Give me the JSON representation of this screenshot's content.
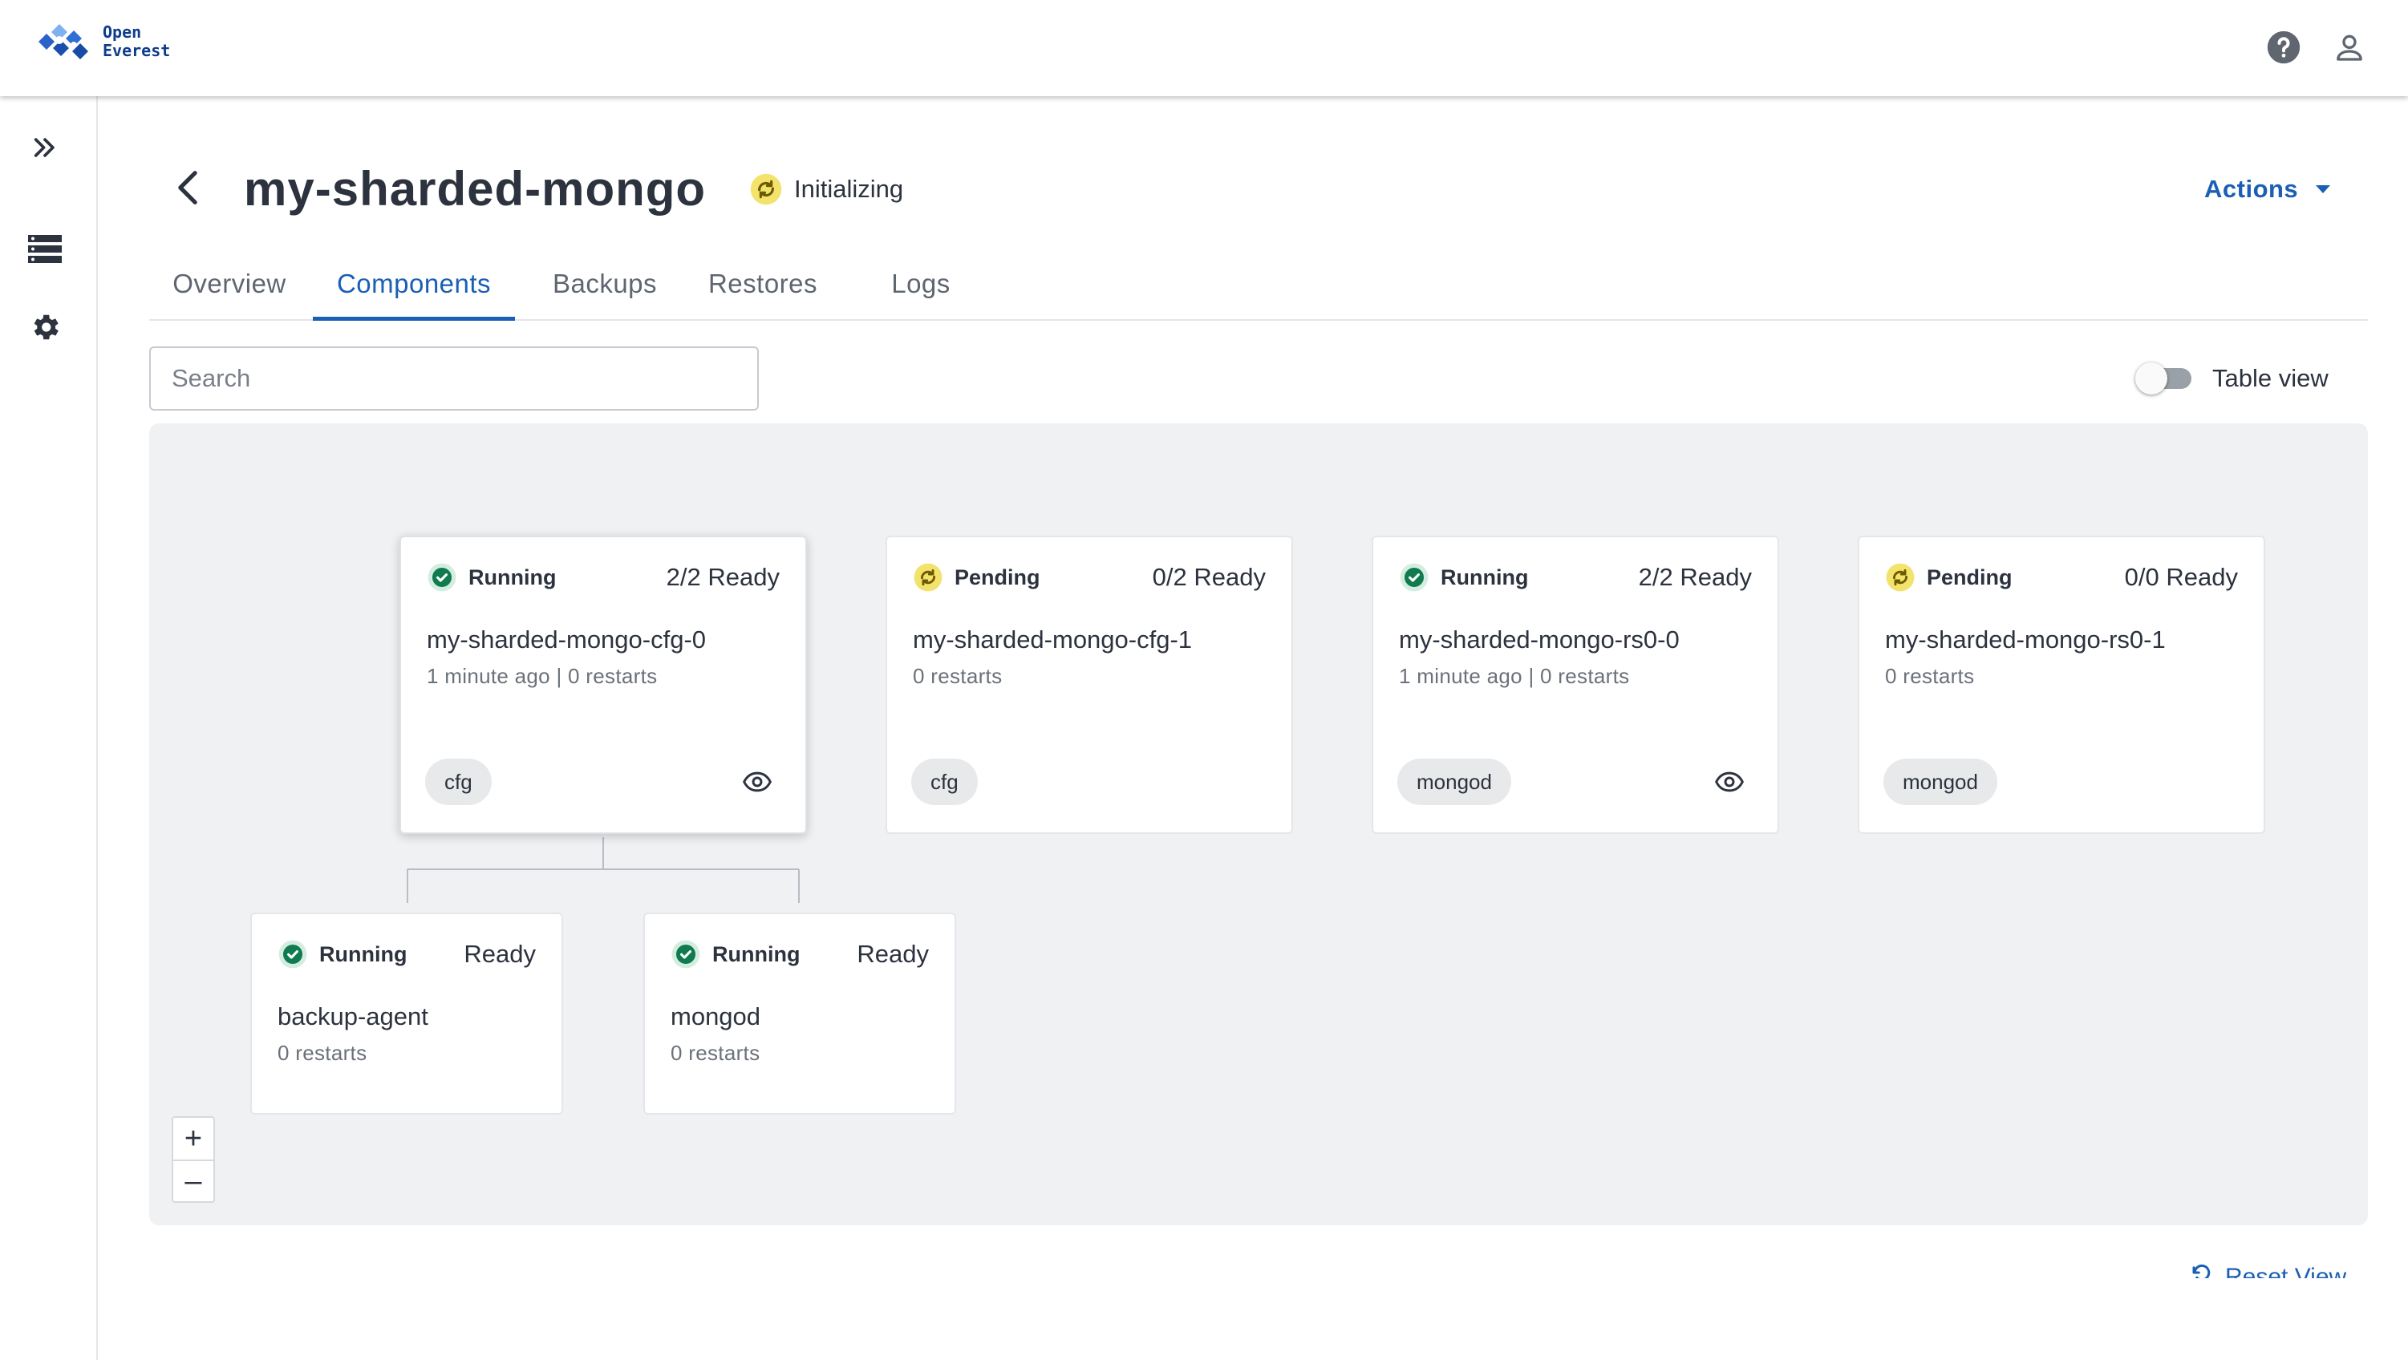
{
  "brand": {
    "line1": "Open",
    "line2": "Everest"
  },
  "colors": {
    "primary": "#1a5fb4",
    "running": "#0f7b4f",
    "pending": "#f3e26b",
    "canvas": "#f0f1f3"
  },
  "header": {
    "title": "my-sharded-mongo",
    "status": "Initializing",
    "actions_label": "Actions"
  },
  "tabs": [
    {
      "label": "Overview",
      "active": false
    },
    {
      "label": "Components",
      "active": true
    },
    {
      "label": "Backups",
      "active": false
    },
    {
      "label": "Restores",
      "active": false
    },
    {
      "label": "Logs",
      "active": false
    }
  ],
  "search": {
    "placeholder": "Search",
    "value": ""
  },
  "table_view": {
    "label": "Table view",
    "on": false
  },
  "components": [
    {
      "status": "Running",
      "ready": "2/2 Ready",
      "name": "my-sharded-mongo-cfg-0",
      "sub": "1 minute ago | 0 restarts",
      "chip": "cfg",
      "has_eye": true,
      "selected": true
    },
    {
      "status": "Pending",
      "ready": "0/2 Ready",
      "name": "my-sharded-mongo-cfg-1",
      "sub": "0 restarts",
      "chip": "cfg",
      "has_eye": false
    },
    {
      "status": "Running",
      "ready": "2/2 Ready",
      "name": "my-sharded-mongo-rs0-0",
      "sub": "1 minute ago | 0 restarts",
      "chip": "mongod",
      "has_eye": true
    },
    {
      "status": "Pending",
      "ready": "0/0 Ready",
      "name": "my-sharded-mongo-rs0-1",
      "sub": "0 restarts",
      "chip": "mongod",
      "has_eye": false
    }
  ],
  "containers": [
    {
      "status": "Running",
      "ready": "Ready",
      "name": "backup-agent",
      "sub": "0 restarts"
    },
    {
      "status": "Running",
      "ready": "Ready",
      "name": "mongod",
      "sub": "0 restarts"
    }
  ],
  "zoom": {
    "in": "+",
    "out": "–"
  },
  "reset_view": "Reset View",
  "icons": {
    "logo": "puzzle-logo-icon",
    "help": "help-icon",
    "user": "user-icon",
    "expand": "chevron-double-right-icon",
    "databases": "database-list-icon",
    "settings": "gear-icon",
    "back": "chevron-left-icon",
    "status_pending": "sync-icon",
    "status_running": "check-circle-icon",
    "view": "eye-icon",
    "reset": "refresh-icon"
  }
}
